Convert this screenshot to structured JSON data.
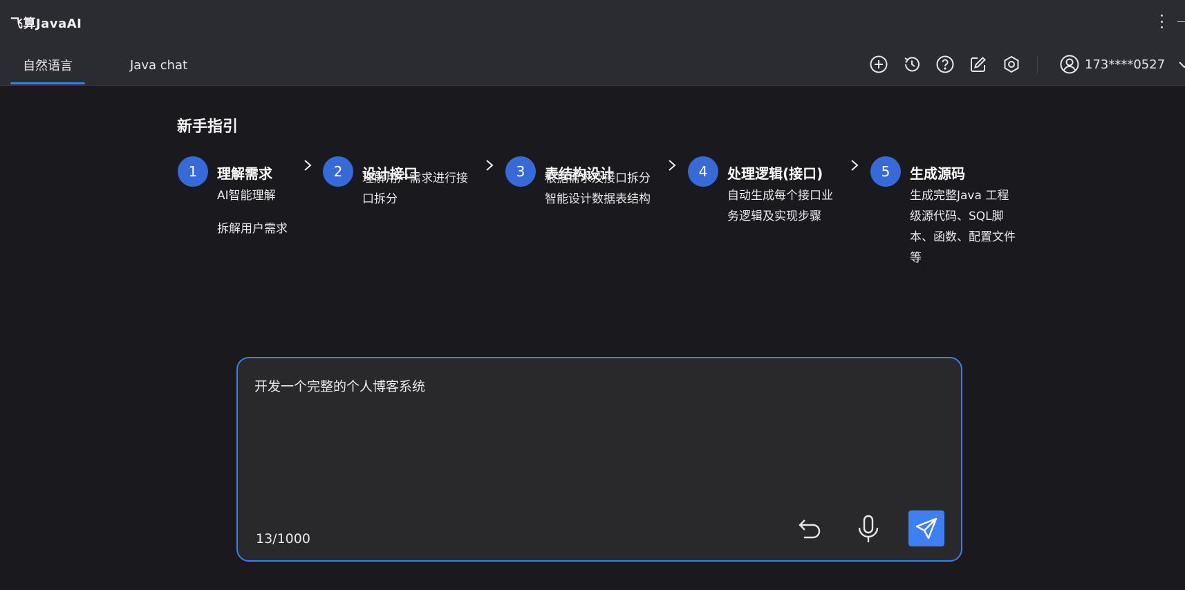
{
  "app": {
    "title": "飞算JavaAI"
  },
  "tabs": [
    {
      "label": "自然语言",
      "active": true
    },
    {
      "label": "Java chat",
      "active": false
    }
  ],
  "toolbar": {
    "icons": [
      "new-icon",
      "history-icon",
      "help-icon",
      "edit-icon",
      "settings-icon"
    ],
    "user_phone": "173****0527"
  },
  "guide": {
    "title": "新手指引",
    "steps": [
      {
        "number": "1",
        "title": "理解需求",
        "desc": [
          "AI智能理解",
          "拆解用户需求"
        ]
      },
      {
        "number": "2",
        "title": "设计接口",
        "desc": [
          "理解用户需求进行接",
          "口拆分"
        ]
      },
      {
        "number": "3",
        "title": "表结构设计",
        "desc": [
          "根据需求及接口拆分",
          "智能设计数据表结构"
        ]
      },
      {
        "number": "4",
        "title": "处理逻辑(接口)",
        "desc": [
          "自动生成每个接口业",
          "务逻辑及实现步骤"
        ]
      },
      {
        "number": "5",
        "title": "生成源码",
        "desc": [
          "生成完整Java 工程",
          "级源代码、SQL脚",
          "本、函数、配置文件",
          "等"
        ]
      }
    ]
  },
  "composer": {
    "text": "开发一个完整的个人博客系统",
    "counter": "13/1000"
  },
  "colors": {
    "accent": "#3c7ef0",
    "step_circle": "#356ad8",
    "send_button": "#3c80f4",
    "header_bg": "#2b2c31",
    "body_bg": "#1a191d",
    "composer_bg": "#29292b"
  }
}
